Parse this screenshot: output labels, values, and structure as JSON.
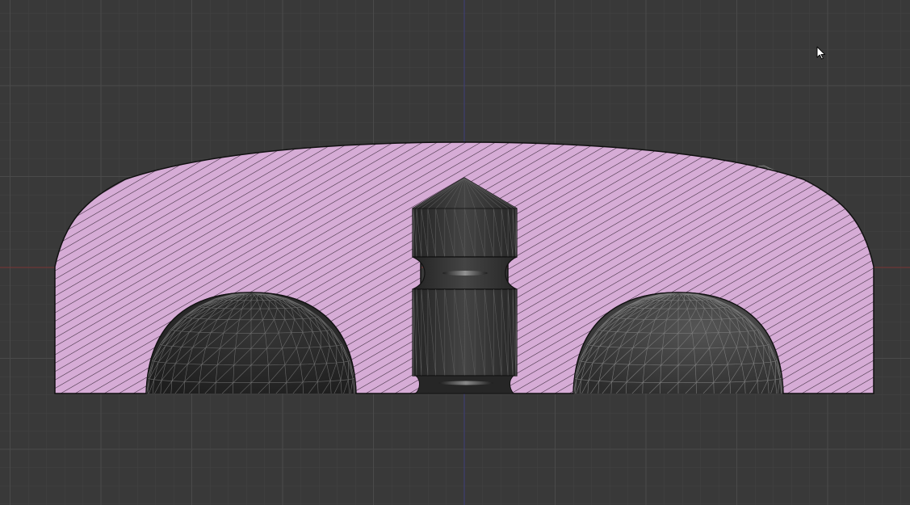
{
  "viewport": {
    "view": "section",
    "background": "#393939",
    "grid_minor_color": "#424242",
    "grid_major_color": "#4a4a4a",
    "axis_x_color": "#7a3535",
    "axis_y_color": "#3f3f7a"
  },
  "section_part": {
    "fill_color": "#d6acd6",
    "hatch_color": "#3a2a3a",
    "outline_color": "#111111"
  },
  "meshes": {
    "left_dome": {
      "shading": "#2a2a2a",
      "wire_color": "#6a6a6a"
    },
    "right_dome": {
      "shading": "#353535",
      "wire_color": "#7a7a7a"
    },
    "center_pin": {
      "shading": "#353535",
      "wire_color": "#5a5a5a"
    },
    "clip_corner": {
      "shading": "#4a4a4a",
      "wire_color": "#8a8a8a"
    }
  },
  "cursor": {
    "icon": "arrow-pointer-icon"
  }
}
